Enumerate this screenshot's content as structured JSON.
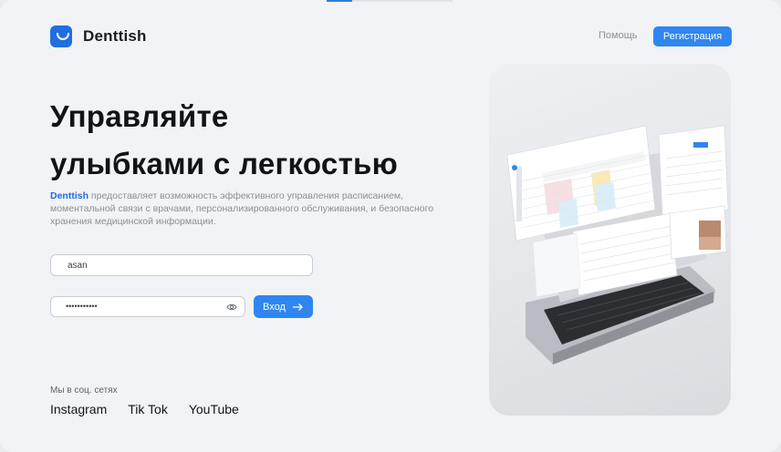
{
  "header": {
    "brand": "Denttish",
    "help": "Помощь",
    "register": "Регистрация"
  },
  "hero": {
    "title_line1": "Управляйте",
    "title_line2": "улыбками с легкостью",
    "desc_brand": "Denttish",
    "desc_rest": " предоставляет возможность эффективного управления расписанием, моментальной связи с врачами, персонализированного обслуживания, и безопасного хранения медицинской информации."
  },
  "form": {
    "login_value": "asan",
    "password_value": "•••••••••••",
    "submit": "Вход"
  },
  "social": {
    "caption": "Мы в соц. сетях",
    "links": [
      "Instagram",
      "Tik Tok",
      "YouTube"
    ]
  },
  "colors": {
    "accent": "#2f86f0",
    "brand": "#1f6fe0",
    "background": "#f2f3f6"
  },
  "icons": [
    "logo-icon",
    "eye-icon",
    "arrow-right-icon"
  ]
}
